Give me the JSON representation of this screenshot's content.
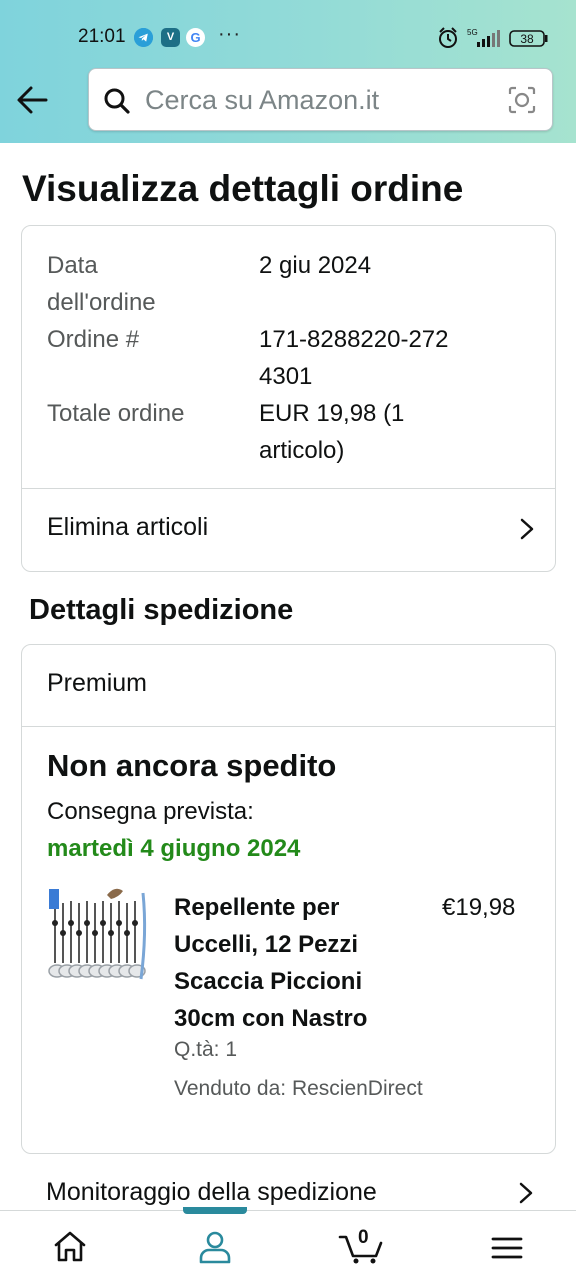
{
  "status_bar": {
    "time": "21:01",
    "app_icons": [
      "telegram-icon",
      "v-app-icon",
      "google-icon"
    ],
    "more": "···",
    "network": "5G",
    "battery": "38"
  },
  "search": {
    "placeholder": "Cerca su Amazon.it"
  },
  "page": {
    "title": "Visualizza dettagli ordine"
  },
  "order_summary": {
    "date_label": "Data dell'ordine",
    "date_value": "2 giu 2024",
    "number_label": "Ordine #",
    "number_value": "171-8288220-2724301",
    "total_label": "Totale ordine",
    "total_value": "EUR 19,98 (1 articolo)",
    "delete_items_label": "Elimina articoli"
  },
  "shipping": {
    "section_title": "Dettagli spedizione",
    "type": "Premium",
    "status": "Non ancora spedito",
    "delivery_label": "Consegna prevista:",
    "delivery_date": "martedì 4 giugno 2024",
    "item": {
      "title": "Repellente per Uccelli, 12 Pezzi Scaccia Piccioni 30cm con Nastro",
      "price": "€19,98",
      "quantity": "Q.tà: 1",
      "seller": "Venduto da: RescienDirect"
    },
    "tracking_label": "Monitoraggio della spedizione"
  },
  "bottom_nav": {
    "items": [
      "home-icon",
      "account-icon",
      "cart-icon",
      "menu-icon"
    ],
    "active": "account-icon",
    "cart_count": "0"
  },
  "colors": {
    "header_start": "#7fd3dc",
    "header_end": "#a6e3cf",
    "delivery_green": "#238a1a",
    "nav_indicator": "#2a8a9d"
  }
}
